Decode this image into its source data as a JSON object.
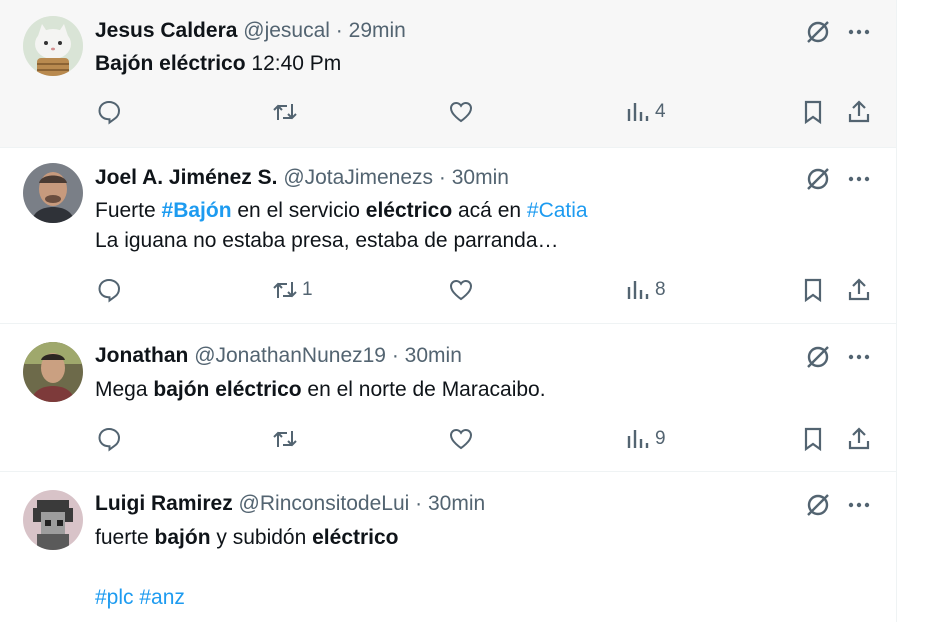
{
  "colors": {
    "accent": "#1d9bf0",
    "muted": "#536471",
    "text": "#0f1419",
    "hover_bg": "#f7f7f7"
  },
  "tweets": [
    {
      "name": "Jesus Caldera",
      "handle": "@jesucal",
      "time": "29min",
      "text_parts": [
        {
          "t": "Bajón eléctrico",
          "style": "bold"
        },
        {
          "t": " 12:40 Pm",
          "style": "plain"
        }
      ],
      "replies": "",
      "retweets": "",
      "likes": "",
      "views": "4",
      "avatar_icon": "cat-avatar"
    },
    {
      "name": "Joel A. Jiménez S.",
      "handle": "@JotaJimenezs",
      "time": "30min",
      "line1_parts": [
        {
          "t": "Fuerte ",
          "style": "plain"
        },
        {
          "t": "#Bajón",
          "style": "hashtag-bold"
        },
        {
          "t": " en el servicio ",
          "style": "plain"
        },
        {
          "t": "eléctrico",
          "style": "bold"
        },
        {
          "t": " acá en ",
          "style": "plain"
        },
        {
          "t": "#Catia",
          "style": "hashtag"
        }
      ],
      "line2": "La iguana no estaba presa, estaba de parranda…",
      "replies": "",
      "retweets": "1",
      "likes": "",
      "views": "8",
      "avatar_icon": "man-avatar"
    },
    {
      "name": "Jonathan",
      "handle": "@JonathanNunez19",
      "time": "30min",
      "text_parts": [
        {
          "t": "Mega ",
          "style": "plain"
        },
        {
          "t": "bajón eléctrico",
          "style": "bold"
        },
        {
          "t": " en el norte de Maracaibo.",
          "style": "plain"
        }
      ],
      "replies": "",
      "retweets": "",
      "likes": "",
      "views": "9",
      "avatar_icon": "man-avatar"
    },
    {
      "name": "Luigi Ramirez",
      "handle": "@RinconsitodeLui",
      "time": "30min",
      "line1_parts": [
        {
          "t": "fuerte ",
          "style": "plain"
        },
        {
          "t": "bajón",
          "style": "bold"
        },
        {
          "t": " y subidón ",
          "style": "plain"
        },
        {
          "t": "eléctrico",
          "style": "bold"
        }
      ],
      "hashtags": [
        "#plc",
        "#anz"
      ],
      "avatar_icon": "pixel-avatar"
    }
  ]
}
